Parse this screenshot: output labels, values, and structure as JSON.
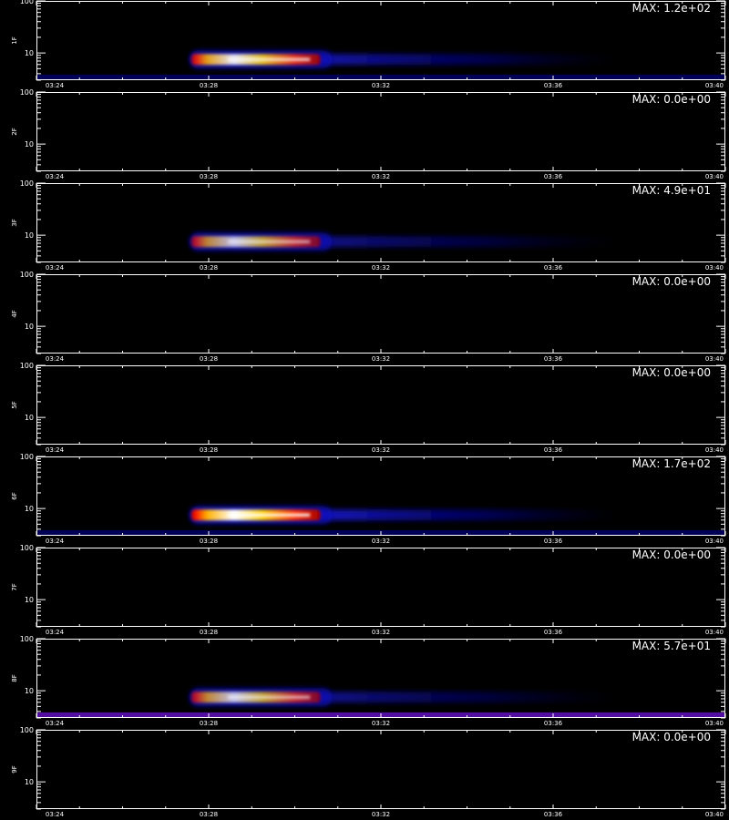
{
  "chart_data": {
    "type": "heatmap",
    "x_tick_labels": [
      "03:24",
      "03:28",
      "03:32",
      "03:36",
      "03:40"
    ],
    "x_ticks_minutes": [
      0,
      4,
      8,
      12,
      16
    ],
    "y_axis": {
      "scale": "log",
      "ylim": [
        3,
        100
      ],
      "tick_labels": [
        "100",
        "10"
      ]
    },
    "colormap": [
      "#000000",
      "#0000a0",
      "#2020ff",
      "#c00000",
      "#ff2000",
      "#ff8000",
      "#ffe000",
      "#ffffff"
    ],
    "panels": [
      {
        "ylabel": "1F",
        "max_label": "MAX: 1.2e+02",
        "max": 120,
        "burst": true,
        "floor_band": true,
        "floor_band_color": "#000060"
      },
      {
        "ylabel": "2F",
        "max_label": "MAX: 0.0e+00",
        "max": 0,
        "burst": false,
        "floor_band": false
      },
      {
        "ylabel": "3F",
        "max_label": "MAX: 4.9e+01",
        "max": 49,
        "burst": true,
        "floor_band": false
      },
      {
        "ylabel": "4F",
        "max_label": "MAX: 0.0e+00",
        "max": 0,
        "burst": false,
        "floor_band": false
      },
      {
        "ylabel": "5F",
        "max_label": "MAX: 0.0e+00",
        "max": 0,
        "burst": false,
        "floor_band": false
      },
      {
        "ylabel": "6F",
        "max_label": "MAX: 1.7e+02",
        "max": 170,
        "burst": true,
        "floor_band": true,
        "floor_band_color": "#000060"
      },
      {
        "ylabel": "7F",
        "max_label": "MAX: 0.0e+00",
        "max": 0,
        "burst": false,
        "floor_band": false
      },
      {
        "ylabel": "8F",
        "max_label": "MAX: 5.7e+01",
        "max": 57,
        "burst": true,
        "floor_band": true,
        "floor_band_color": "#5a10b0"
      },
      {
        "ylabel": "9F",
        "max_label": "MAX: 0.0e+00",
        "max": 0,
        "burst": false,
        "floor_band": false
      }
    ],
    "burst": {
      "start_minutes": 3.6,
      "peak_minutes": 5.4,
      "core_end_minutes": 6.6,
      "tail_end_minutes": 13.5,
      "y_center": 7.5
    }
  }
}
